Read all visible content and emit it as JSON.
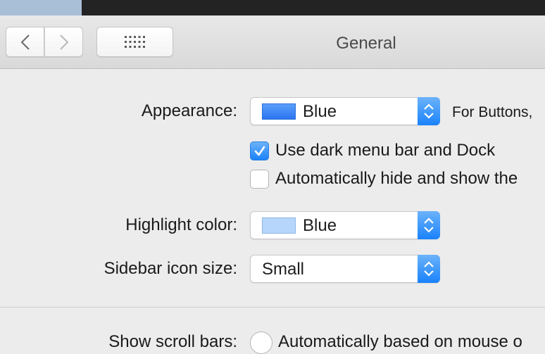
{
  "window": {
    "title": "General"
  },
  "toolbar": {
    "back_icon": "chevron-left-icon",
    "forward_icon": "chevron-right-icon",
    "grid_icon": "show-all-grid-icon"
  },
  "appearance": {
    "label": "Appearance:",
    "value": "Blue",
    "swatch_color": "#3d8bf7",
    "aside": "For Buttons,"
  },
  "dark_menu": {
    "label": "Use dark menu bar and Dock",
    "checked": true
  },
  "auto_hide": {
    "label": "Automatically hide and show the",
    "checked": false
  },
  "highlight": {
    "label": "Highlight color:",
    "value": "Blue",
    "swatch_color": "#b6d6fc"
  },
  "sidebar_icon": {
    "label": "Sidebar icon size:",
    "value": "Small"
  },
  "scroll_bars": {
    "label": "Show scroll bars:",
    "option": "Automatically based on mouse o"
  },
  "colors": {
    "accent": "#1a82fb",
    "background": "#ececec"
  }
}
